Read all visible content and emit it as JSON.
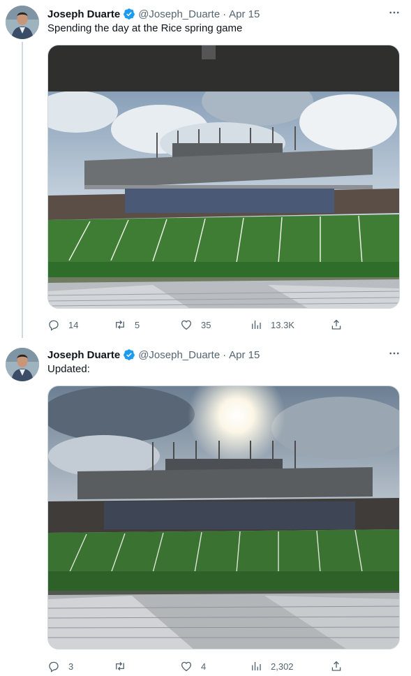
{
  "tweets": [
    {
      "author": {
        "name": "Joseph Duarte",
        "handle": "@Joseph_Duarte",
        "verified": true
      },
      "separator": "·",
      "date": "Apr 15",
      "text": "Spending the day at the Rice spring game",
      "media": {
        "description": "Rice football stadium from upper deck, overhang roof visible, cloudy sky"
      },
      "stats": {
        "replies": "14",
        "retweets": "5",
        "likes": "35",
        "views": "13.3K"
      }
    },
    {
      "author": {
        "name": "Joseph Duarte",
        "handle": "@Joseph_Duarte",
        "verified": true
      },
      "separator": "·",
      "date": "Apr 15",
      "text": "Updated:",
      "media": {
        "description": "Rice football stadium at sunset, sun behind clouds, bleachers in foreground"
      },
      "stats": {
        "replies": "3",
        "retweets": "",
        "likes": "4",
        "views": "2,302"
      }
    }
  ],
  "colors": {
    "accent": "#1d9bf0",
    "secondary_text": "#536471",
    "field_green": "#3f7d34"
  }
}
